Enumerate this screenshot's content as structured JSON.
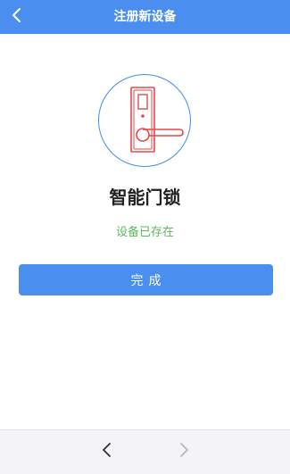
{
  "header": {
    "title": "注册新设备",
    "back_icon": "chevron-left-icon"
  },
  "device": {
    "icon": "door-lock-icon",
    "name": "智能门锁",
    "status": "设备已存在"
  },
  "actions": {
    "done_label": "完成"
  },
  "browser_nav": {
    "back_icon": "chevron-left-icon",
    "forward_icon": "chevron-right-icon",
    "forward_enabled": false
  },
  "colors": {
    "header_bg": "#4a8ff0",
    "button_bg": "#4a8ff0",
    "status_text": "#5cb85c",
    "lock_icon": "#e8474a",
    "circle_border": "#3f8fe8"
  }
}
